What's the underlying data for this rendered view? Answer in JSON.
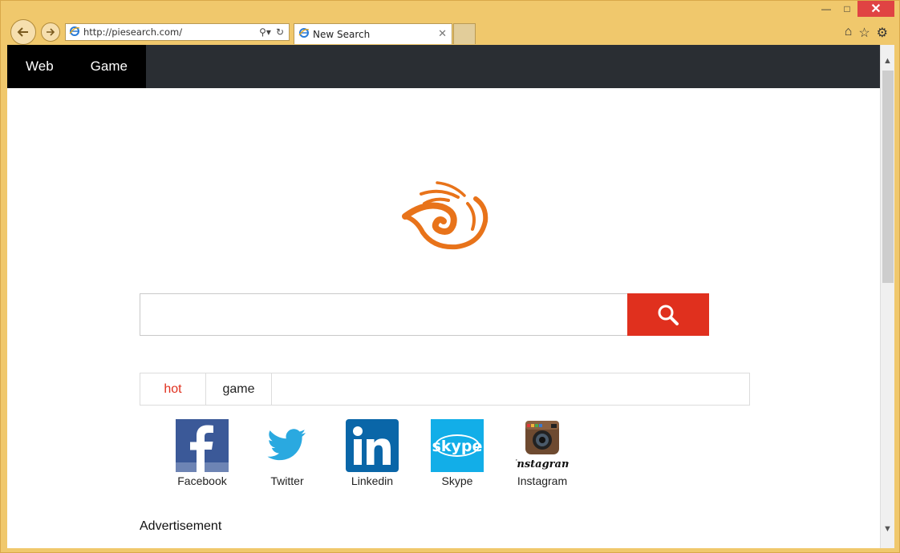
{
  "browser": {
    "address_url": "http://piesearch.com/",
    "tab_title": "New Search"
  },
  "nav": {
    "items": [
      {
        "label": "Web"
      },
      {
        "label": "Game"
      }
    ]
  },
  "search": {
    "placeholder": "",
    "value": ""
  },
  "tabs": [
    {
      "label": "hot"
    },
    {
      "label": "game"
    }
  ],
  "sites": [
    {
      "label": "Facebook",
      "icon": "facebook-icon"
    },
    {
      "label": "Twitter",
      "icon": "twitter-icon"
    },
    {
      "label": "Linkedin",
      "icon": "linkedin-icon"
    },
    {
      "label": "Skype",
      "icon": "skype-icon"
    },
    {
      "label": "Instagram",
      "icon": "instagram-icon"
    }
  ],
  "advertisement_label": "Advertisement",
  "colors": {
    "accent": "#e0301e",
    "nav_bg": "#2a2e33",
    "frame": "#f0c86c",
    "logo": "#e8731a"
  }
}
